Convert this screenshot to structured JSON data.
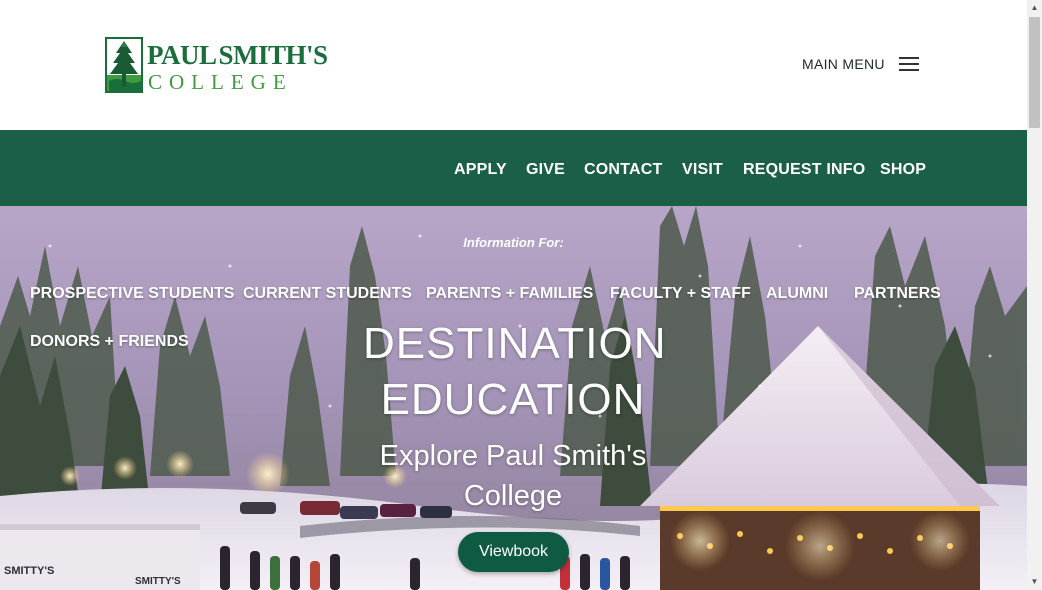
{
  "header": {
    "logo_line1_a": "PAUL",
    "logo_line1_b": "SMITH'S",
    "logo_line2": "COLLEGE",
    "menu_label": "MAIN MENU"
  },
  "nav": [
    "APPLY",
    "GIVE",
    "CONTACT",
    "VISIT",
    "REQUEST INFO",
    "SHOP"
  ],
  "hero": {
    "info_label": "Information For:",
    "audiences": [
      "PROSPECTIVE STUDENTS",
      "CURRENT STUDENTS",
      "PARENTS + FAMILIES",
      "FACULTY + STAFF",
      "ALUMNI",
      "PARTNERS",
      "DONORS + FRIENDS"
    ],
    "title_line1": "DESTINATION",
    "title_line2": "EDUCATION",
    "subtitle_line1": "Explore Paul Smith's",
    "subtitle_line2": "College",
    "button_label": "Viewbook"
  },
  "colors": {
    "brand_green": "#1c5f49",
    "logo_green": "#1a6e3c",
    "logo_light_green": "#3f9b3f",
    "button_green": "#0f5a43"
  },
  "icons": {
    "menu": "hamburger-icon",
    "logo": "pine-tree-icon"
  }
}
